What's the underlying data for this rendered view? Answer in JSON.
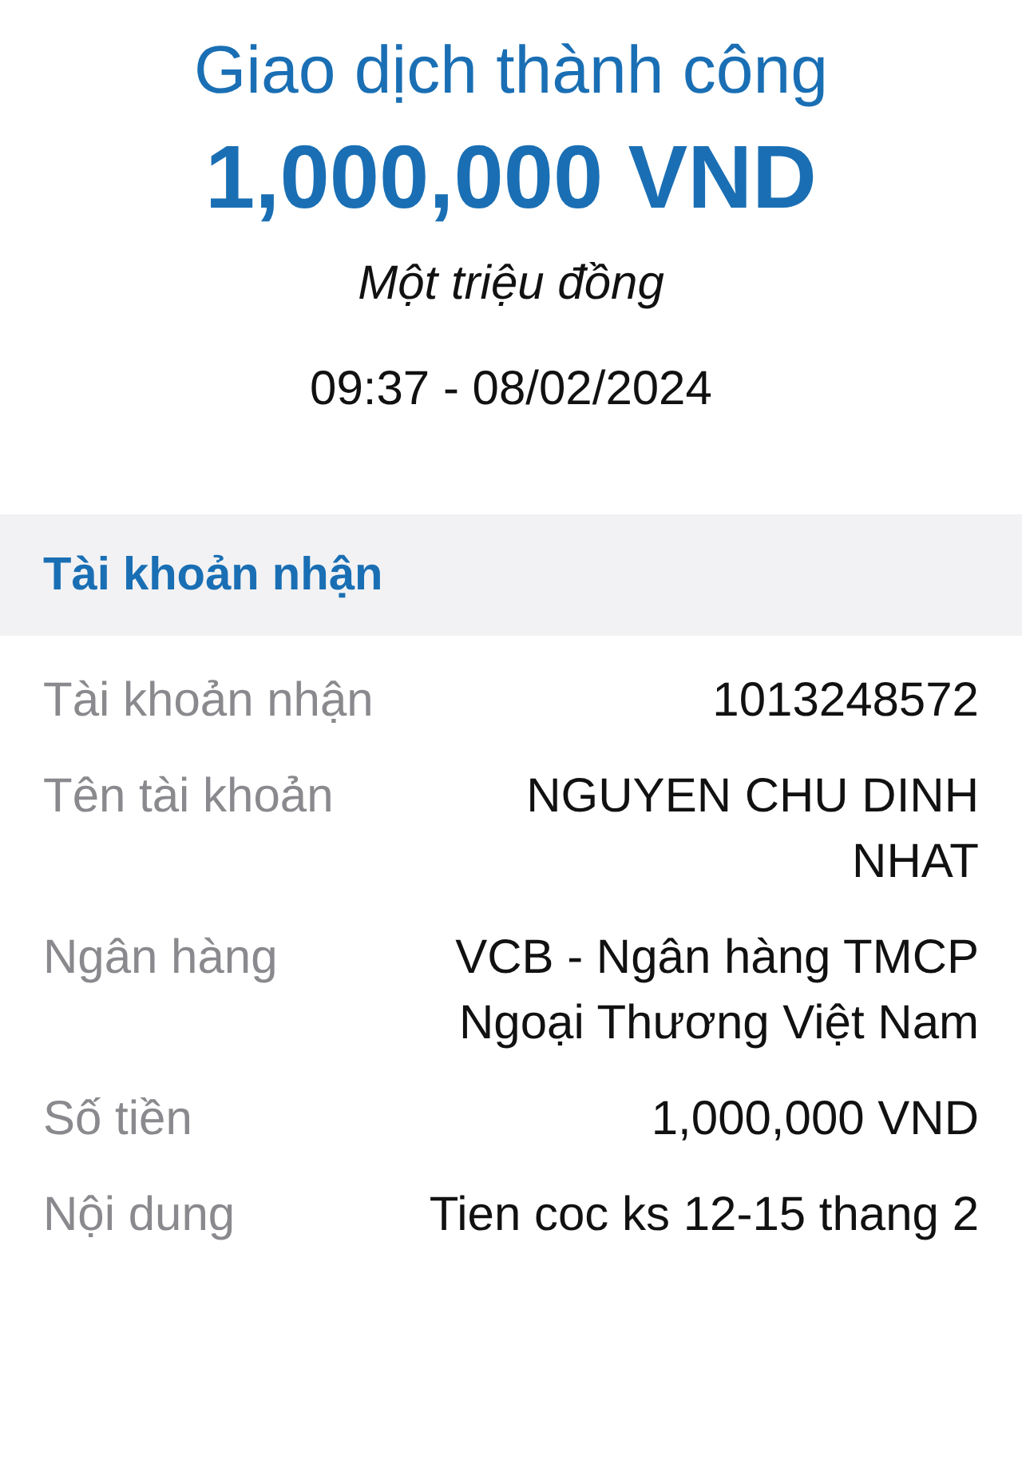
{
  "header": {
    "status": "Giao dịch thành công",
    "amount": "1,000,000 VND",
    "amount_in_words": "Một triệu đồng",
    "datetime": "09:37 - 08/02/2024"
  },
  "section": {
    "title": "Tài khoản nhận",
    "rows": [
      {
        "label": "Tài khoản nhận",
        "value": "1013248572"
      },
      {
        "label": "Tên tài khoản",
        "value": "NGUYEN CHU DINH NHAT"
      },
      {
        "label": "Ngân hàng",
        "value": "VCB - Ngân hàng TMCP Ngoại Thương Việt Nam"
      },
      {
        "label": "Số tiền",
        "value": "1,000,000 VND"
      },
      {
        "label": "Nội dung",
        "value": "Tien coc ks 12-15 thang 2"
      }
    ]
  }
}
